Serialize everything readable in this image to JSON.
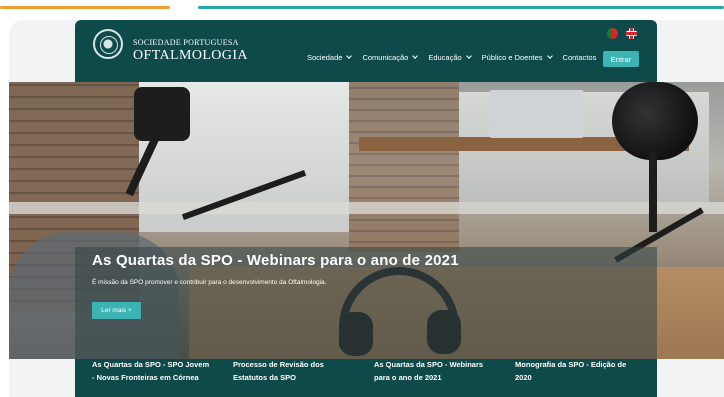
{
  "header": {
    "brand_small": "SOCIEDADE PORTUGUESA",
    "brand_main": "OFTALMOLOGIA",
    "nav": [
      {
        "label": "Sociedade",
        "has_dropdown": true
      },
      {
        "label": "Comunicação",
        "has_dropdown": true
      },
      {
        "label": "Educação",
        "has_dropdown": true
      },
      {
        "label": "Público e Doentes",
        "has_dropdown": true
      },
      {
        "label": "Contactos",
        "has_dropdown": false
      }
    ],
    "login_label": "Entrar",
    "languages": [
      "pt-flag-icon",
      "uk-flag-icon"
    ]
  },
  "hero": {
    "title": "As Quartas da SPO - Webinars para o ano de 2021",
    "description": "É missão da SPO promover e contribuir para o desenvolvimento da Oftalmologia.",
    "button_label": "Ler mais +"
  },
  "news": [
    {
      "title": "As Quartas da SPO - SPO Jovem - Novas Fronteiras em Córnea"
    },
    {
      "title": "Processo de Revisão dos Estatutos da SPO"
    },
    {
      "title": "As Quartas da SPO - Webinars para o ano de 2021"
    },
    {
      "title": "Monografia da SPO - Edição de 2020"
    }
  ],
  "colors": {
    "header_bg": "#0f4a4a",
    "accent_teal": "#3cb4b4",
    "accent_orange": "#f0a030"
  }
}
